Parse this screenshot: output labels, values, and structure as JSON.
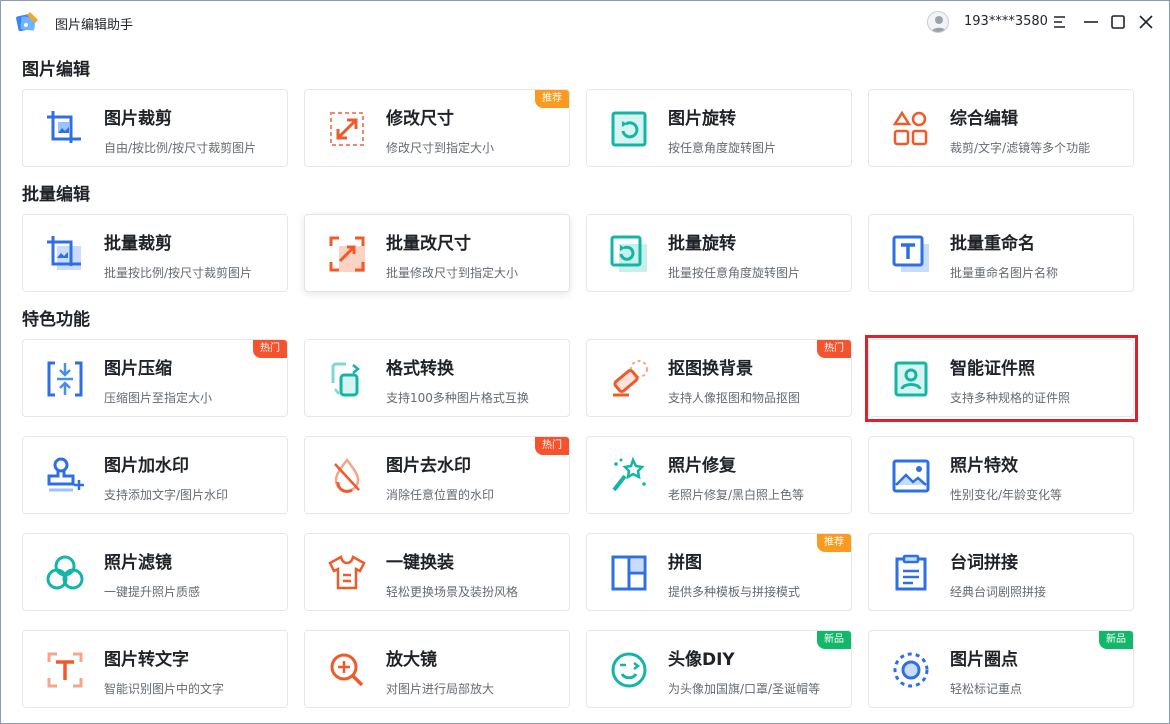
{
  "app": {
    "title": "图片编辑助手",
    "phone": "193****3580"
  },
  "colors": {
    "hot": "#f5532d",
    "recommend": "#fa9a1f",
    "new": "#12b76a",
    "highlight": "#e0202a"
  },
  "sections": [
    {
      "title": "图片编辑"
    },
    {
      "title": "批量编辑"
    },
    {
      "title": "特色功能"
    }
  ],
  "cards": [
    {
      "icon": "crop-icon",
      "title": "图片裁剪",
      "desc": "自由/按比例/按尺寸裁剪图片",
      "badge": ""
    },
    {
      "icon": "resize-arrows-icon",
      "title": "修改尺寸",
      "desc": "修改尺寸到指定大小",
      "badge": "推荐",
      "badge_type": "recommend"
    },
    {
      "icon": "rotate-icon",
      "title": "图片旋转",
      "desc": "按任意角度旋转图片",
      "badge": ""
    },
    {
      "icon": "shapes-icon",
      "title": "综合编辑",
      "desc": "裁剪/文字/滤镜等多个功能",
      "badge": ""
    },
    {
      "icon": "batch-crop-icon",
      "title": "批量裁剪",
      "desc": "批量按比例/按尺寸裁剪图片",
      "badge": ""
    },
    {
      "icon": "batch-resize-icon",
      "title": "批量改尺寸",
      "desc": "批量修改尺寸到指定大小",
      "badge": ""
    },
    {
      "icon": "batch-rotate-icon",
      "title": "批量旋转",
      "desc": "批量按任意角度旋转图片",
      "badge": ""
    },
    {
      "icon": "batch-rename-icon",
      "title": "批量重命名",
      "desc": "批量重命名图片名称",
      "badge": ""
    },
    {
      "icon": "compress-icon",
      "title": "图片压缩",
      "desc": "压缩图片至指定大小",
      "badge": "热门",
      "badge_type": "hot"
    },
    {
      "icon": "format-convert-icon",
      "title": "格式转换",
      "desc": "支持100多种图片格式互换",
      "badge": ""
    },
    {
      "icon": "eraser-icon",
      "title": "抠图换背景",
      "desc": "支持人像抠图和物品抠图",
      "badge": "热门",
      "badge_type": "hot"
    },
    {
      "icon": "id-photo-icon",
      "title": "智能证件照",
      "desc": "支持多种规格的证件照",
      "badge": ""
    },
    {
      "icon": "stamp-icon",
      "title": "图片加水印",
      "desc": "支持添加文字/图片水印",
      "badge": ""
    },
    {
      "icon": "remove-watermark-icon",
      "title": "图片去水印",
      "desc": "消除任意位置的水印",
      "badge": "热门",
      "badge_type": "hot"
    },
    {
      "icon": "magic-wand-icon",
      "title": "照片修复",
      "desc": "老照片修复/黑白照上色等",
      "badge": ""
    },
    {
      "icon": "landscape-icon",
      "title": "照片特效",
      "desc": "性别变化/年龄变化等",
      "badge": ""
    },
    {
      "icon": "filter-circles-icon",
      "title": "照片滤镜",
      "desc": "一键提升照片质感",
      "badge": ""
    },
    {
      "icon": "shirt-icon",
      "title": "一键换装",
      "desc": "轻松更换场景及装扮风格",
      "badge": ""
    },
    {
      "icon": "collage-icon",
      "title": "拼图",
      "desc": "提供多种模板与拼接模式",
      "badge": "推荐",
      "badge_type": "recommend"
    },
    {
      "icon": "clipboard-icon",
      "title": "台词拼接",
      "desc": "经典台词剧照拼接",
      "badge": ""
    },
    {
      "icon": "ocr-text-icon",
      "title": "图片转文字",
      "desc": "智能识别图片中的文字",
      "badge": ""
    },
    {
      "icon": "magnifier-icon",
      "title": "放大镜",
      "desc": "对图片进行局部放大",
      "badge": ""
    },
    {
      "icon": "smiley-icon",
      "title": "头像DIY",
      "desc": "为头像加国旗/口罩/圣诞帽等",
      "badge": "新品",
      "badge_type": "new"
    },
    {
      "icon": "target-circle-icon",
      "title": "图片圈点",
      "desc": "轻松标记重点",
      "badge": "新品",
      "badge_type": "new"
    }
  ]
}
